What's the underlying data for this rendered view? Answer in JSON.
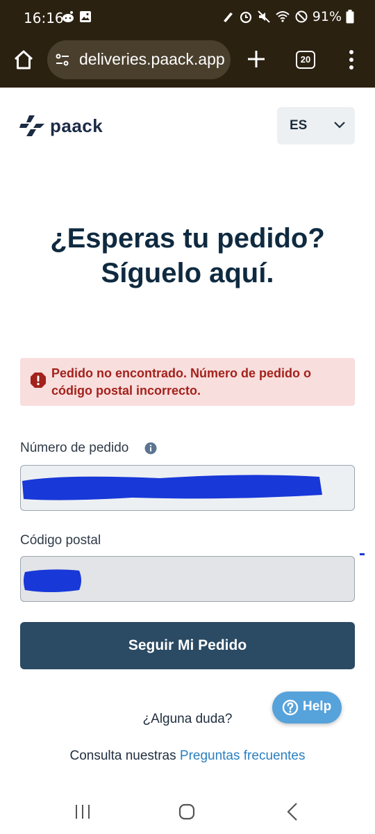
{
  "status_bar": {
    "time": "16:16",
    "battery": "91%"
  },
  "browser": {
    "url": "deliveries.paack.app",
    "tab_count": "20"
  },
  "header": {
    "logo_text": "paack",
    "language": "ES"
  },
  "hero": {
    "title_line1": "¿Esperas tu pedido?",
    "title_line2": "Síguelo aquí."
  },
  "error": {
    "message": "Pedido no encontrado. Número de pedido o código postal incorrecto."
  },
  "form": {
    "order_label": "Número de pedido",
    "order_value": "",
    "postal_label": "Código postal",
    "postal_value": "",
    "submit_label": "Seguir Mi Pedido"
  },
  "help": {
    "button_label": "Help"
  },
  "footer": {
    "question": "¿Alguna duda?",
    "faq_prefix": "Consulta nuestras ",
    "faq_link": "Preguntas frecuentes"
  },
  "colors": {
    "brand_dark": "#2b4a63",
    "error_bg": "#f8dedd",
    "error_text": "#a3221c",
    "link": "#2a7fc1",
    "help_bg": "#56a2db",
    "redaction": "#1838d8"
  }
}
